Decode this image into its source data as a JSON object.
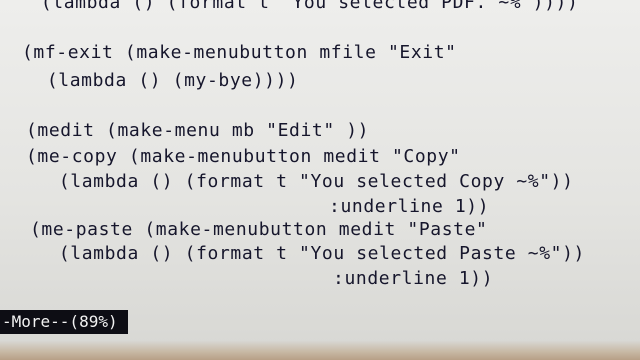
{
  "code_lines": [
    "  (lambda () (format t \"You selected PDF. ~%\"))))",
    "(mf-exit (make-menubutton mfile \"Exit\"",
    "  (lambda () (my-bye))))",
    "(medit (make-menu mb \"Edit\" ))",
    "(me-copy (make-menubutton medit \"Copy\"",
    "  (lambda () (format t \"You selected Copy ~%\"))",
    "                       :underline 1))",
    "(me-paste (make-menubutton medit \"Paste\"",
    "  (lambda () (format t \"You selected Paste ~%\"))",
    "                       :underline 1))"
  ],
  "status": {
    "text": "-More--(89%)"
  },
  "colors": {
    "text": "#16162c",
    "background": "#eeeeec",
    "status_bg": "#0d0d14",
    "status_fg": "#f2f2f2"
  }
}
